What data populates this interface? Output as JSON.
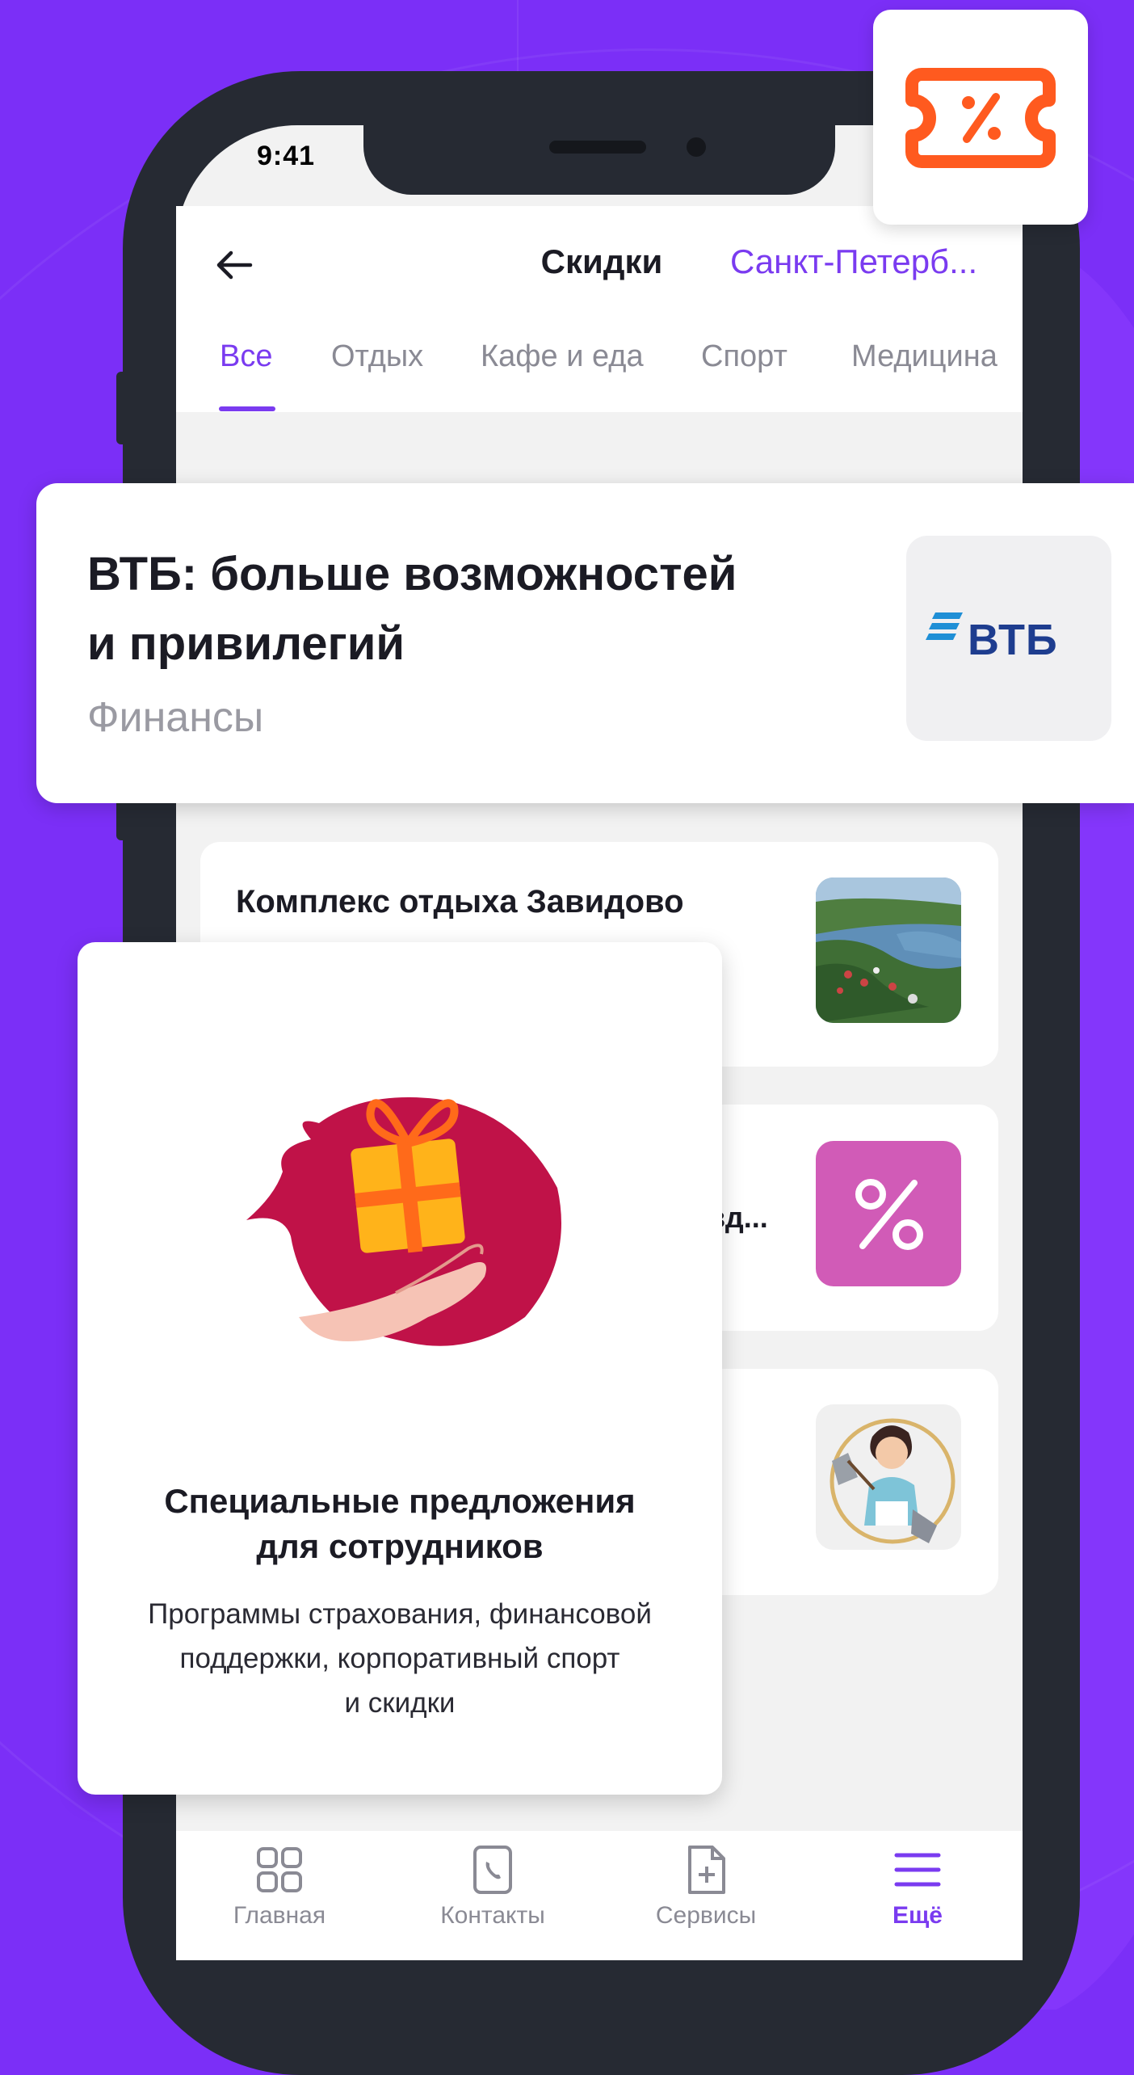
{
  "status_bar": {
    "time": "9:41"
  },
  "header": {
    "title": "Скидки",
    "city": "Санкт-Петерб..."
  },
  "tabs": [
    {
      "label": "Все",
      "active": true
    },
    {
      "label": "Отдых"
    },
    {
      "label": "Кафе и еда"
    },
    {
      "label": "Спорт"
    },
    {
      "label": "Медицина"
    }
  ],
  "featured": {
    "title_line1": "ВТБ: больше возможностей",
    "title_line2": "и привилегий",
    "category": "Финансы",
    "logo_text": "ВТБ"
  },
  "list_items": [
    {
      "title": "Комплекс отдыха Завидово",
      "thumb": "landscape-photo"
    },
    {
      "title_fragment": "зд...",
      "thumb": "percent-icon"
    },
    {
      "thumb": "cleaning-lady-illustration"
    }
  ],
  "promo": {
    "heading_line1": "Специальные предложения",
    "heading_line2": "для сотрудников",
    "text_line1": "Программы страхования, финансовой",
    "text_line2": "поддержки, корпоративный спорт",
    "text_line3": "и скидки"
  },
  "bottom_nav": [
    {
      "label": "Главная",
      "icon": "grid-icon"
    },
    {
      "label": "Контакты",
      "icon": "phone-icon"
    },
    {
      "label": "Сервисы",
      "icon": "file-plus-icon"
    },
    {
      "label": "Ещё",
      "icon": "menu-icon",
      "active": true
    }
  ],
  "colors": {
    "background": "#7b2ff7",
    "accent": "#7a3bf0",
    "coupon": "#ff5a1f",
    "vtb_blue": "#1e3d8f",
    "percent_tile": "#d15bb7"
  }
}
